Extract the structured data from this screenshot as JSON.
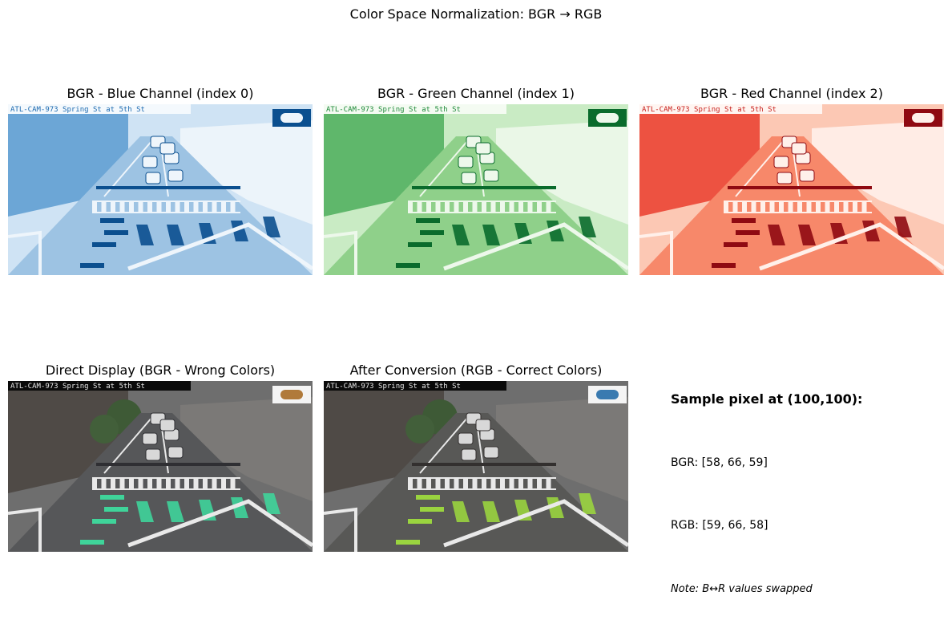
{
  "figure": {
    "title": "Color Space Normalization: BGR → RGB"
  },
  "panels": [
    {
      "title": "BGR - Blue Channel (index 0)",
      "palette": "blue",
      "camera_label": "ATL-CAM-973  Spring St at 5th St"
    },
    {
      "title": "BGR - Green Channel (index 1)",
      "palette": "green",
      "camera_label": "ATL-CAM-973  Spring St at 5th St"
    },
    {
      "title": "BGR - Red Channel (index 2)",
      "palette": "red",
      "camera_label": "ATL-CAM-973  Spring St at 5th St"
    },
    {
      "title": "Direct Display (BGR - Wrong Colors)",
      "palette": "bgr",
      "camera_label": "ATL-CAM-973  Spring St at 5th St"
    },
    {
      "title": "After Conversion (RGB - Correct Colors)",
      "palette": "rgb",
      "camera_label": "ATL-CAM-973  Spring St at 5th St"
    }
  ],
  "sample_info": {
    "title": "Sample pixel at (100,100):",
    "bgr_line": "BGR: [58, 66, 59]",
    "rgb_line": "RGB: [59, 66, 58]",
    "note": "Note: B↔R values swapped"
  },
  "palettes": {
    "blue": {
      "bg": "#cfe3f4",
      "road": "#9dc3e3",
      "light": "#eef5fb",
      "dark": "#0b4f8f",
      "mid": "#5a9bd0",
      "label_bar": "#f4f9fd",
      "label_text": "#1c6ab0",
      "accent": "#eef5fb"
    },
    "green": {
      "bg": "#c9ebc4",
      "road": "#8fd08a",
      "light": "#edf8eb",
      "dark": "#0a6b2c",
      "mid": "#4cae5c",
      "label_bar": "#f4fbf2",
      "label_text": "#1f8a3a",
      "accent": "#edf8eb"
    },
    "red": {
      "bg": "#fcc8b4",
      "road": "#f7886a",
      "light": "#fff0ea",
      "dark": "#8f0a12",
      "mid": "#ea3d2d",
      "label_bar": "#fff5f1",
      "label_text": "#c8201c",
      "accent": "#fff0ea"
    },
    "bgr": {
      "bg": "#6e6e6e",
      "road": "#565759",
      "light": "#e9e9e9",
      "dark": "#2f2f33",
      "mid": "#8a8b8d",
      "label_bar": "#0a0a0a",
      "label_text": "#e8e8e8",
      "accent": "#3fd49a"
    },
    "rgb": {
      "bg": "#6e6e6e",
      "road": "#585856",
      "light": "#e9e9e9",
      "dark": "#33302f",
      "mid": "#8d8b8a",
      "label_bar": "#0a0a0a",
      "label_text": "#e8e8e8",
      "accent": "#9ad43f"
    }
  }
}
